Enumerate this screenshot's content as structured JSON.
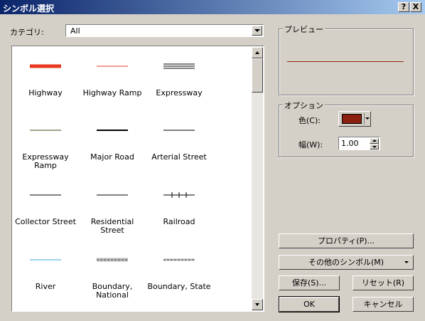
{
  "window": {
    "title": "シンボル選択",
    "help_glyph": "?",
    "close_glyph": "X"
  },
  "category": {
    "label": "カテゴリ:",
    "value": "All"
  },
  "symbols": [
    {
      "name": "Highway",
      "color": "#e8391f",
      "style": "thick"
    },
    {
      "name": "Highway Ramp",
      "color": "#e8391f",
      "style": "thin"
    },
    {
      "name": "Expressway",
      "color": "#000000",
      "style": "triple"
    },
    {
      "name": "Expressway Ramp",
      "color": "#4a4a1a",
      "style": "thin"
    },
    {
      "name": "Major Road",
      "color": "#000000",
      "style": "medium"
    },
    {
      "name": "Arterial Street",
      "color": "#000000",
      "style": "thin"
    },
    {
      "name": "Collector Street",
      "color": "#000000",
      "style": "thin"
    },
    {
      "name": "Residential Street",
      "color": "#000000",
      "style": "thin"
    },
    {
      "name": "Railroad",
      "color": "#000000",
      "style": "rail"
    },
    {
      "name": "River",
      "color": "#3aa8d8",
      "style": "thin"
    },
    {
      "name": "Boundary, National",
      "color": "#888888",
      "style": "boundary"
    },
    {
      "name": "Boundary, State",
      "color": "#888888",
      "style": "dashed"
    }
  ],
  "preview": {
    "label": "プレビュー",
    "color": "#8b2a10"
  },
  "options": {
    "label": "オプション",
    "color_label": "色(C):",
    "color_value": "#8b2010",
    "width_label": "幅(W):",
    "width_value": "1.00"
  },
  "buttons": {
    "properties": "プロパティ(P)...",
    "more_symbols": "その他のシンボル(M)",
    "save": "保存(S)...",
    "reset": "リセット(R)",
    "ok": "OK",
    "cancel": "キャンセル"
  }
}
